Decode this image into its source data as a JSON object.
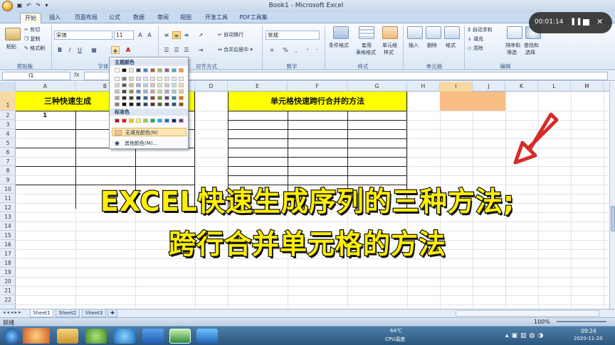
{
  "window": {
    "title": "Book1 - Microsoft Excel"
  },
  "tabs": [
    "开始",
    "插入",
    "页面布局",
    "公式",
    "数据",
    "审阅",
    "视图",
    "开发工具",
    "PDF工具集"
  ],
  "ribbon": {
    "clipboard": {
      "paste": "粘贴",
      "cut": "剪切",
      "copy": "复制",
      "format_painter": "格式刷",
      "label": "剪贴板"
    },
    "font": {
      "name": "宋体",
      "size": "11",
      "label": "字体",
      "bold": "B",
      "italic": "I",
      "underline": "U"
    },
    "alignment": {
      "wrap": "自动换行",
      "merge": "合并后居中",
      "label": "对齐方式"
    },
    "number": {
      "format": "常规",
      "percent": "%",
      "comma": ",",
      "label": "数字"
    },
    "styles": {
      "conditional": "条件格式",
      "table_1": "套用",
      "table_2": "表格格式",
      "cell_1": "单元格",
      "cell_2": "样式",
      "label": "样式"
    },
    "cells": {
      "insert": "插入",
      "delete": "删除",
      "format": "格式",
      "label": "单元格"
    },
    "editing": {
      "autosum": "自动求和",
      "fill": "填充",
      "clear": "清除",
      "sort_1": "排序和",
      "sort_2": "筛选",
      "find_1": "查找和",
      "find_2": "选择",
      "label": "编辑"
    }
  },
  "formula_bar": {
    "name_box": "I1",
    "fx": "fx"
  },
  "columns": [
    "A",
    "B",
    "C",
    "D",
    "E",
    "F",
    "G",
    "H",
    "I",
    "J",
    "K",
    "L",
    "M"
  ],
  "rows": [
    "1",
    "2",
    "3",
    "4",
    "5",
    "6",
    "7",
    "8",
    "9",
    "10",
    "11",
    "12",
    "13",
    "14",
    "15",
    "16",
    "17",
    "18",
    "19",
    "20",
    "21",
    "22"
  ],
  "cells": {
    "a1": "三种快速生成",
    "e1": "单元格快速跨行合并的方法",
    "a2": "1"
  },
  "palette": {
    "theme_title": "主题颜色",
    "standard_title": "标准色",
    "no_fill": "无填充颜色(N)",
    "more_colors": "其他颜色(M)...",
    "theme_colors": [
      [
        "#ffffff",
        "#000000",
        "#eeece1",
        "#1f497d",
        "#4f81bd",
        "#c0504d",
        "#9bbb59",
        "#8064a2",
        "#4bacc6",
        "#f79646"
      ],
      [
        "#f2f2f2",
        "#7f7f7f",
        "#ddd9c3",
        "#c6d9f0",
        "#dbe5f1",
        "#f2dcdb",
        "#ebf1dd",
        "#e5e0ec",
        "#dbeef3",
        "#fdeada"
      ],
      [
        "#d8d8d8",
        "#595959",
        "#c4bd97",
        "#8db3e2",
        "#b8cce4",
        "#e5b9b7",
        "#d7e3bc",
        "#ccc1d9",
        "#b7dde8",
        "#fbd5b5"
      ],
      [
        "#bfbfbf",
        "#3f3f3f",
        "#938953",
        "#548dd4",
        "#95b3d7",
        "#d99694",
        "#c3d69b",
        "#b2a2c7",
        "#92cddc",
        "#fac08f"
      ],
      [
        "#a5a5a5",
        "#262626",
        "#494429",
        "#17365d",
        "#366092",
        "#953734",
        "#76923c",
        "#5f497a",
        "#31859b",
        "#e36c09"
      ],
      [
        "#7f7f7f",
        "#0c0c0c",
        "#1d1b10",
        "#0f243e",
        "#244061",
        "#632423",
        "#4f6128",
        "#3f3151",
        "#205867",
        "#974806"
      ]
    ],
    "standard_colors": [
      "#c00000",
      "#ff0000",
      "#ffc000",
      "#ffff00",
      "#92d050",
      "#00b050",
      "#00b0f0",
      "#0070c0",
      "#002060",
      "#7030a0"
    ]
  },
  "sheets": [
    "Sheet1",
    "Sheet2",
    "Sheet3"
  ],
  "status": {
    "ready": "就绪",
    "zoom": "100%"
  },
  "taskbar": {
    "temp": "64℃",
    "cpu": "CPU温度",
    "time": "09:24",
    "date": "2020-11-20"
  },
  "recorder": {
    "time": "00:01:14"
  },
  "overlay": {
    "line1": "EXCEL快速生成序列的三种方法;",
    "line2": "跨行合并单元格的方法"
  },
  "colors": {
    "yellow": "#ffff00",
    "selected_fill": "#f9bd86",
    "arrow": "#d62b2b"
  }
}
